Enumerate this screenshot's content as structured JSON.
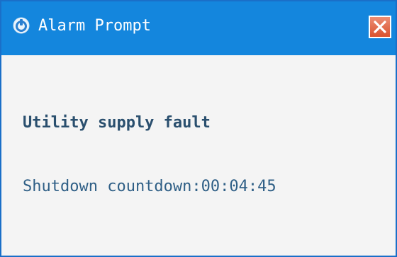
{
  "window": {
    "title": "Alarm Prompt",
    "app_icon": "power-icon",
    "close_icon": "close-icon"
  },
  "alarm": {
    "message": "Utility supply fault",
    "countdown_label": "Shutdown countdown:",
    "countdown_value": "00:04:45"
  },
  "colors": {
    "titlebar": "#1486dd",
    "close_button": "#d9532f",
    "text": "#2f5f86",
    "background": "#f4f4f4"
  }
}
